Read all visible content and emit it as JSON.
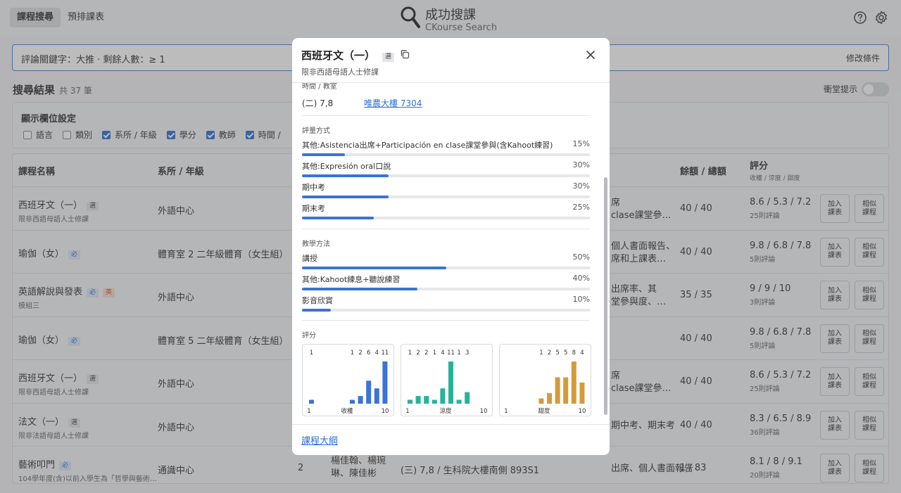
{
  "header": {
    "tabs": [
      {
        "label": "課程搜尋",
        "active": true
      },
      {
        "label": "預排課表",
        "active": false
      }
    ],
    "app_title": "成功搜課",
    "app_subtitle": "CKourse Search",
    "help_icon": "help-circle-icon",
    "settings_icon": "gear-icon"
  },
  "query": {
    "text": "評論關鍵字：大推 · 剩餘人數：≥ 1",
    "modify_label": "修改條件"
  },
  "results": {
    "title": "搜尋結果",
    "count": "共 37 筆",
    "rush_label": "衝堂提示",
    "rush_on": false
  },
  "column_settings": {
    "title": "顯示欄位設定",
    "options": [
      {
        "label": "語言",
        "checked": false
      },
      {
        "label": "類別",
        "checked": false
      },
      {
        "label": "系所 / 年級",
        "checked": true
      },
      {
        "label": "學分",
        "checked": true
      },
      {
        "label": "教師",
        "checked": true
      },
      {
        "label": "時間 /",
        "checked": true
      }
    ]
  },
  "table": {
    "headers": {
      "name": "課程名稱",
      "dept": "系所 / 年級",
      "quota": "餘額 / 總額",
      "rating": "評分",
      "rating_sub": "收穫 / 涼度 / 甜度"
    },
    "add_label": "加入課表",
    "similar_label": "相似課程",
    "rows": [
      {
        "name": "西班牙文（一）",
        "badges": [
          {
            "t": "選",
            "k": "gray"
          }
        ],
        "sub": "限非西語母語人士修課",
        "dept": "外語中心",
        "eval1": "席",
        "eval2": "clase課堂參…",
        "quota": "40 / 40",
        "rating": "8.6 / 5.3 / 7.2",
        "reviews": "25則評論"
      },
      {
        "name": "瑜伽（女）",
        "badges": [
          {
            "t": "必",
            "k": "blue"
          }
        ],
        "sub": "",
        "dept": "體育室 2 二年級體育（女生組）",
        "eval1": "個人書面報告、",
        "eval2": "席和上課表…",
        "quota": "40 / 40",
        "rating": "9.8 / 6.8 / 7.8",
        "reviews": "5則評論"
      },
      {
        "name": "英語解說與發表",
        "badges": [
          {
            "t": "必",
            "k": "blue"
          },
          {
            "t": "英",
            "k": "red"
          }
        ],
        "sub": "模組三",
        "dept": "外語中心",
        "eval1": "出席率、其",
        "eval2": "堂參與度、…",
        "quota": "35 / 35",
        "rating": "9 / 9 / 10",
        "reviews": "3則評論"
      },
      {
        "name": "瑜伽（女）",
        "badges": [
          {
            "t": "必",
            "k": "blue"
          }
        ],
        "sub": "",
        "dept": "體育室 5 二年級體育（女生組）",
        "eval1": "",
        "eval2": "",
        "quota": "40 / 40",
        "rating": "9.8 / 6.8 / 7.8",
        "reviews": "5則評論"
      },
      {
        "name": "西班牙文（一）",
        "badges": [
          {
            "t": "選",
            "k": "gray"
          }
        ],
        "sub": "限非西語母語人士修課",
        "dept": "外語中心",
        "eval1": "席",
        "eval2": "clase課堂參…",
        "quota": "40 / 40",
        "rating": "8.6 / 5.3 / 7.2",
        "reviews": "25則評論"
      },
      {
        "name": "法文（一）",
        "badges": [
          {
            "t": "選",
            "k": "gray"
          }
        ],
        "sub": "限非法語母語人士修課",
        "dept": "外語中心",
        "eval1": "期中考、期末考",
        "eval2": "",
        "quota": "40 / 40",
        "rating": "8.3 / 6.5 / 8.9",
        "reviews": "36則評論"
      },
      {
        "name": "藝術叩門",
        "badges": [
          {
            "t": "必",
            "k": "blue"
          }
        ],
        "sub": "104學年度(含)以前入學生為「哲學與藝術…",
        "dept": "通識中心",
        "credit": "2",
        "teacher1": "楊佳翰、楊琬",
        "teacher2": "琳、陳佳彬",
        "time": "(三) 7,8 / 生科院大樓南側 893S1",
        "eval1": "出席、個人書面報告",
        "eval2": "",
        "quota": "1 / 83",
        "rating": "8.1 / 8 / 9.1",
        "reviews": "20則評論"
      }
    ]
  },
  "modal": {
    "title": "西班牙文（一）",
    "badge": "選",
    "subtitle": "限非西語母語人士修課",
    "copy_icon": "copy-icon",
    "close_icon": "close-icon",
    "time_label": "時間 / 教室",
    "time": "(二) 7,8",
    "room": "唯農大樓 7304",
    "grading_label": "評量方式",
    "grading": [
      {
        "label": "其他:Asistencia出席+Participación en clase課堂參與(含Kahoot練習)",
        "pct": "15%",
        "value": 15
      },
      {
        "label": "其他:Expresión oral口說",
        "pct": "30%",
        "value": 30
      },
      {
        "label": "期中考",
        "pct": "30%",
        "value": 30
      },
      {
        "label": "期末考",
        "pct": "25%",
        "value": 25
      }
    ],
    "method_label": "教學方法",
    "methods": [
      {
        "label": "講授",
        "pct": "50%",
        "value": 50
      },
      {
        "label": "其他:Kahoot練息+聽說練習",
        "pct": "40%",
        "value": 40
      },
      {
        "label": "影音欣賞",
        "pct": "10%",
        "value": 10
      }
    ],
    "rating_label": "評分",
    "histograms": [
      {
        "name": "收穫",
        "color": "#3b73d8",
        "counts": [
          1,
          0,
          0,
          0,
          0,
          1,
          2,
          6,
          4,
          11
        ],
        "min": "1",
        "max": "10"
      },
      {
        "name": "涼度",
        "color": "#27b39a",
        "counts": [
          1,
          2,
          2,
          1,
          4,
          11,
          1,
          3,
          0,
          0
        ],
        "min": "1",
        "max": "10"
      },
      {
        "name": "甜度",
        "color": "#d39b3b",
        "counts": [
          0,
          0,
          0,
          0,
          1,
          2,
          5,
          5,
          8,
          4
        ],
        "min": "1",
        "max": "10"
      }
    ],
    "syllabus_link": "課程大綱"
  }
}
